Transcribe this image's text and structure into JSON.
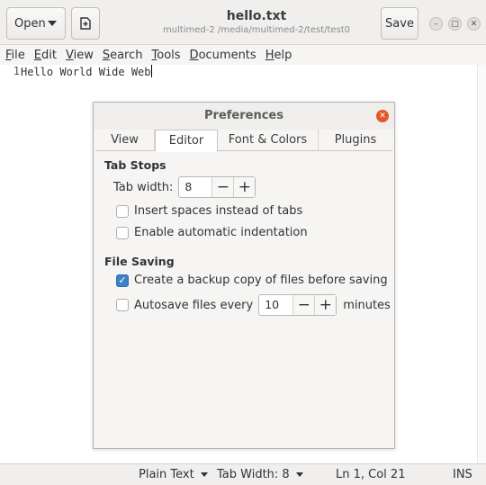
{
  "header": {
    "open_label": "Open",
    "save_label": "Save",
    "title": "hello.txt",
    "subtitle": "multimed-2 /media/multimed-2/test/test0"
  },
  "menu": [
    {
      "label": "File",
      "mnemonic": "F",
      "rest": "ile"
    },
    {
      "label": "Edit",
      "mnemonic": "E",
      "rest": "dit"
    },
    {
      "label": "View",
      "mnemonic": "V",
      "rest": "iew"
    },
    {
      "label": "Search",
      "mnemonic": "S",
      "rest": "earch"
    },
    {
      "label": "Tools",
      "mnemonic": "T",
      "rest": "ools"
    },
    {
      "label": "Documents",
      "mnemonic": "D",
      "rest": "ocuments"
    },
    {
      "label": "Help",
      "mnemonic": "H",
      "rest": "elp"
    }
  ],
  "editor": {
    "line_number": "1",
    "text": "Hello World Wide Web"
  },
  "dialog": {
    "title": "Preferences",
    "tabs": [
      "View",
      "Editor",
      "Font & Colors",
      "Plugins"
    ],
    "active_tab": "Editor",
    "tab_stops": {
      "heading": "Tab Stops",
      "tab_width_label": "Tab width:",
      "tab_width_value": "8",
      "insert_spaces_label": "Insert spaces instead of tabs",
      "insert_spaces_checked": false,
      "auto_indent_label": "Enable automatic indentation",
      "auto_indent_checked": false
    },
    "file_saving": {
      "heading": "File Saving",
      "backup_label": "Create a backup copy of files before saving",
      "backup_checked": true,
      "autosave_label": "Autosave files every",
      "autosave_checked": false,
      "autosave_value": "10",
      "autosave_unit": "minutes"
    }
  },
  "statusbar": {
    "syntax": "Plain Text",
    "tab_width": "Tab Width: 8",
    "position": "Ln 1, Col 21",
    "mode": "INS"
  },
  "colors": {
    "accent": "#3d80c7",
    "close_button": "#e5562b"
  }
}
